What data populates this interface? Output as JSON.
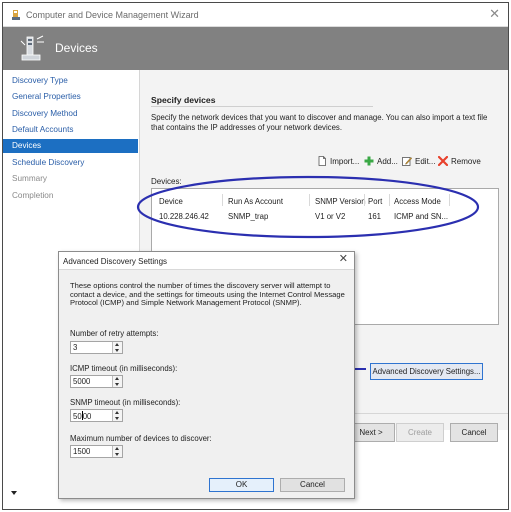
{
  "window": {
    "title": "Computer and Device Management Wizard",
    "close_glyph": "✕",
    "icon": "server-wizard-icon"
  },
  "header": {
    "title": "Devices",
    "icon": "devices-icon"
  },
  "nav": {
    "items": [
      {
        "label": "Discovery Type",
        "state": "link"
      },
      {
        "label": "General Properties",
        "state": "link"
      },
      {
        "label": "Discovery Method",
        "state": "link"
      },
      {
        "label": "Default Accounts",
        "state": "link"
      },
      {
        "label": "Devices",
        "state": "active"
      },
      {
        "label": "Schedule Discovery",
        "state": "link"
      },
      {
        "label": "Summary",
        "state": "disabled"
      },
      {
        "label": "Completion",
        "state": "disabled"
      }
    ]
  },
  "main": {
    "section_title": "Specify devices",
    "description": "Specify the network devices that you want to discover and manage. You can also import a text file that contains the IP addresses of your network devices.",
    "toolbar": {
      "import_label": "Import...",
      "add_label": "Add...",
      "edit_label": "Edit...",
      "remove_label": "Remove"
    },
    "devices_label": "Devices:",
    "table": {
      "columns": [
        "Device",
        "Run As Account",
        "SNMP Version",
        "Port",
        "Access Mode"
      ],
      "rows": [
        [
          "10.228.246.42",
          "SNMP_trap",
          "V1 or V2",
          "161",
          "ICMP and SN..."
        ]
      ]
    },
    "advanced_button": "Advanced Discovery Settings...",
    "buttons": {
      "next": "Next >",
      "create": "Create",
      "cancel": "Cancel"
    }
  },
  "dialog": {
    "title": "Advanced Discovery Settings",
    "close_glyph": "✕",
    "description": "These options control the number of times the discovery server will attempt to contact a device, and the settings for timeouts using the Internet Control Message Protocol (ICMP) and Simple Network Management Protocol (SNMP).",
    "fields": {
      "retry_label": "Number of retry attempts:",
      "retry_value": "3",
      "icmp_label": "ICMP timeout (in milliseconds):",
      "icmp_value": "5000",
      "snmp_label": "SNMP timeout (in milliseconds):",
      "snmp_value_before_cursor": "50",
      "snmp_value_after_cursor": "00",
      "max_label": "Maximum number of devices to discover:",
      "max_value": "1500"
    },
    "ok_label": "OK",
    "cancel_label": "Cancel"
  },
  "colors": {
    "header_band": "#818181",
    "nav_active": "#1c6fc2",
    "nav_link": "#2a5ea8",
    "annotation_ellipse": "#2b2fb0",
    "annotation_arrow": "#2b2fb0",
    "add_icon": "#3aa845",
    "remove_icon": "#e8412c"
  }
}
